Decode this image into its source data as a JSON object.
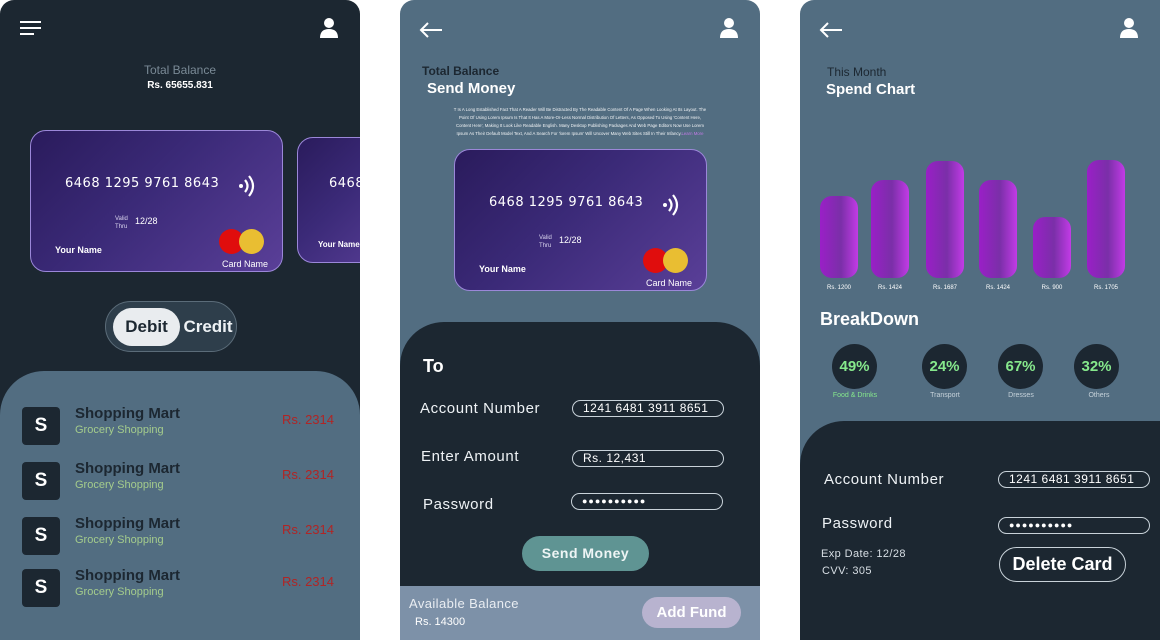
{
  "screen1": {
    "total_balance_label": "Total Balance",
    "total_balance_value": "Rs. 65655.831",
    "cards": [
      {
        "number": "6468 1295 9761 8643",
        "valid_label": "Valid\nThru",
        "valid_thru": "12/28",
        "holder": "Your Name",
        "card_name": "Card Name"
      },
      {
        "number": "6468",
        "holder": "Your Name"
      }
    ],
    "toggle": {
      "debit": "Debit",
      "credit": "Credit",
      "selected": "Debit"
    },
    "transactions": [
      {
        "avatar": "S",
        "title": "Shopping Mart",
        "subtitle": "Grocery Shopping",
        "amount": "Rs. 2314"
      },
      {
        "avatar": "S",
        "title": "Shopping Mart",
        "subtitle": "Grocery Shopping",
        "amount": "Rs. 2314"
      },
      {
        "avatar": "S",
        "title": "Shopping Mart",
        "subtitle": "Grocery Shopping",
        "amount": "Rs. 2314"
      },
      {
        "avatar": "S",
        "title": "Shopping Mart",
        "subtitle": "Grocery Shopping",
        "amount": "Rs. 2314"
      }
    ]
  },
  "screen2": {
    "total_balance_label": "Total Balance",
    "title": "Send Money",
    "description_line1": "T Is A Long Established Fact That A Reader Will Be Distracted By The Readable Content Of A Page When Looking At Its Layout. The",
    "description_line2": "Point Of Using Lorem Ipsum Is That It Has A More-Or-Less Normal Distribution Of Letters, As Opposed To Using 'Content Here,",
    "description_line3": "Content Here', Making It Look Like Readable English. Many Desktop Publishing Packages And Web Page Editors Now Use Lorem",
    "description_line4": "Ipsum As Their Default Model Text, And A Search For 'lorem Ipsum' Will Uncover Many Web Sites Still In Their Infancy.",
    "learn_more": "Learn More",
    "card": {
      "number": "6468 1295 9761 8643",
      "valid_label": "Valid\nThru",
      "valid_thru": "12/28",
      "holder": "Your Name",
      "card_name": "Card Name"
    },
    "to_label": "To",
    "account_number_label": "Account Number",
    "account_number_value": "1241 6481 3911 8651",
    "amount_label": "Enter Amount",
    "amount_value": "Rs. 12,431",
    "password_label": "Password",
    "password_value": "●●●●●●●●●●",
    "send_button": "Send Money",
    "available_balance_label": "Available Balance",
    "available_balance_value": "Rs. 14300",
    "add_fund_button": "Add Fund"
  },
  "screen3": {
    "this_month": "This Month",
    "title": "Spend Chart",
    "breakdown_title": "BreakDown",
    "breakdown": [
      {
        "pct": "49%",
        "label": "Food & Drinks",
        "color": "#86e88c"
      },
      {
        "pct": "24%",
        "label": "Transport",
        "color": "#c6d2da"
      },
      {
        "pct": "67%",
        "label": "Dresses",
        "color": "#c6d2da"
      },
      {
        "pct": "32%",
        "label": "Others",
        "color": "#c6d2da"
      }
    ],
    "account_number_label": "Account Number",
    "account_number_value": "1241 6481 3911 8651",
    "password_label": "Password",
    "password_value": "●●●●●●●●●●",
    "exp_date": "Exp Date: 12/28",
    "cvv": "CVV: 305",
    "delete_button": "Delete Card"
  },
  "chart_data": {
    "type": "bar",
    "title": "Spend Chart",
    "categories": [
      "Rs. 1200",
      "Rs. 1424",
      "Rs. 1687",
      "Rs. 1424",
      "Rs. 900",
      "Rs. 1705"
    ],
    "values": [
      1200,
      1424,
      1687,
      1424,
      900,
      1705
    ],
    "tick_labels": [
      "Rs. 1200",
      "Rs. 1424",
      "Rs. 1687",
      "Rs. 1424",
      "Rs. 900",
      "Rs. 1705"
    ],
    "xlabel": "",
    "ylabel": "",
    "grid": false
  },
  "colors": {
    "dark": "#1c2731",
    "slate": "#526d81",
    "light_slate": "#5c7487",
    "accent_teal": "#5f9493",
    "red": "#b02525",
    "green": "#86e88c"
  },
  "icons": [
    "menu-icon",
    "user-icon",
    "back-arrow-icon",
    "contactless-icon"
  ]
}
